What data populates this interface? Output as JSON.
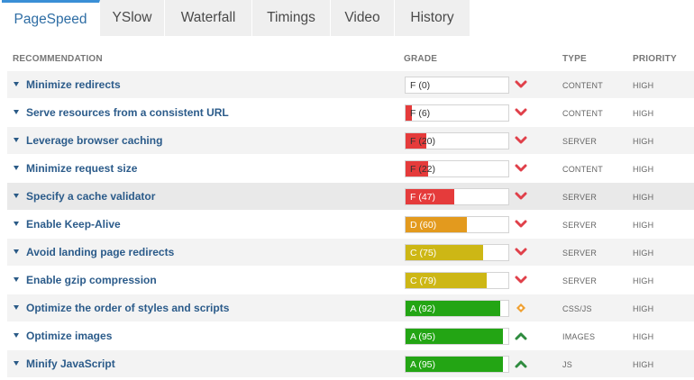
{
  "tabs": [
    {
      "label": "PageSpeed",
      "active": true
    },
    {
      "label": "YSlow",
      "active": false
    },
    {
      "label": "Waterfall",
      "active": false
    },
    {
      "label": "Timings",
      "active": false
    },
    {
      "label": "Video",
      "active": false
    },
    {
      "label": "History",
      "active": false
    }
  ],
  "columns": {
    "recommendation": "RECOMMENDATION",
    "grade": "GRADE",
    "type": "TYPE",
    "priority": "PRIORITY"
  },
  "grade_colors": {
    "F": "#e53b3b",
    "D": "#e39a1e",
    "C": "#cdb715",
    "A": "#23a514"
  },
  "rows": [
    {
      "name": "Minimize redirects",
      "grade_text": "F (0)",
      "letter": "F",
      "score": 0,
      "trend": "down",
      "type": "CONTENT",
      "priority": "HIGH"
    },
    {
      "name": "Serve resources from a consistent URL",
      "grade_text": "F (6)",
      "letter": "F",
      "score": 6,
      "trend": "down",
      "type": "CONTENT",
      "priority": "HIGH"
    },
    {
      "name": "Leverage browser caching",
      "grade_text": "F (20)",
      "letter": "F",
      "score": 20,
      "trend": "down",
      "type": "SERVER",
      "priority": "HIGH"
    },
    {
      "name": "Minimize request size",
      "grade_text": "F (22)",
      "letter": "F",
      "score": 22,
      "trend": "down",
      "type": "CONTENT",
      "priority": "HIGH"
    },
    {
      "name": "Specify a cache validator",
      "grade_text": "F (47)",
      "letter": "F",
      "score": 47,
      "trend": "down",
      "type": "SERVER",
      "priority": "HIGH"
    },
    {
      "name": "Enable Keep-Alive",
      "grade_text": "D (60)",
      "letter": "D",
      "score": 60,
      "trend": "down",
      "type": "SERVER",
      "priority": "HIGH"
    },
    {
      "name": "Avoid landing page redirects",
      "grade_text": "C (75)",
      "letter": "C",
      "score": 75,
      "trend": "down",
      "type": "SERVER",
      "priority": "HIGH"
    },
    {
      "name": "Enable gzip compression",
      "grade_text": "C (79)",
      "letter": "C",
      "score": 79,
      "trend": "down",
      "type": "SERVER",
      "priority": "HIGH"
    },
    {
      "name": "Optimize the order of styles and scripts",
      "grade_text": "A (92)",
      "letter": "A",
      "score": 92,
      "trend": "neutral",
      "type": "CSS/JS",
      "priority": "HIGH"
    },
    {
      "name": "Optimize images",
      "grade_text": "A (95)",
      "letter": "A",
      "score": 95,
      "trend": "up",
      "type": "IMAGES",
      "priority": "HIGH"
    },
    {
      "name": "Minify JavaScript",
      "grade_text": "A (95)",
      "letter": "A",
      "score": 95,
      "trend": "up",
      "type": "JS",
      "priority": "HIGH"
    }
  ]
}
